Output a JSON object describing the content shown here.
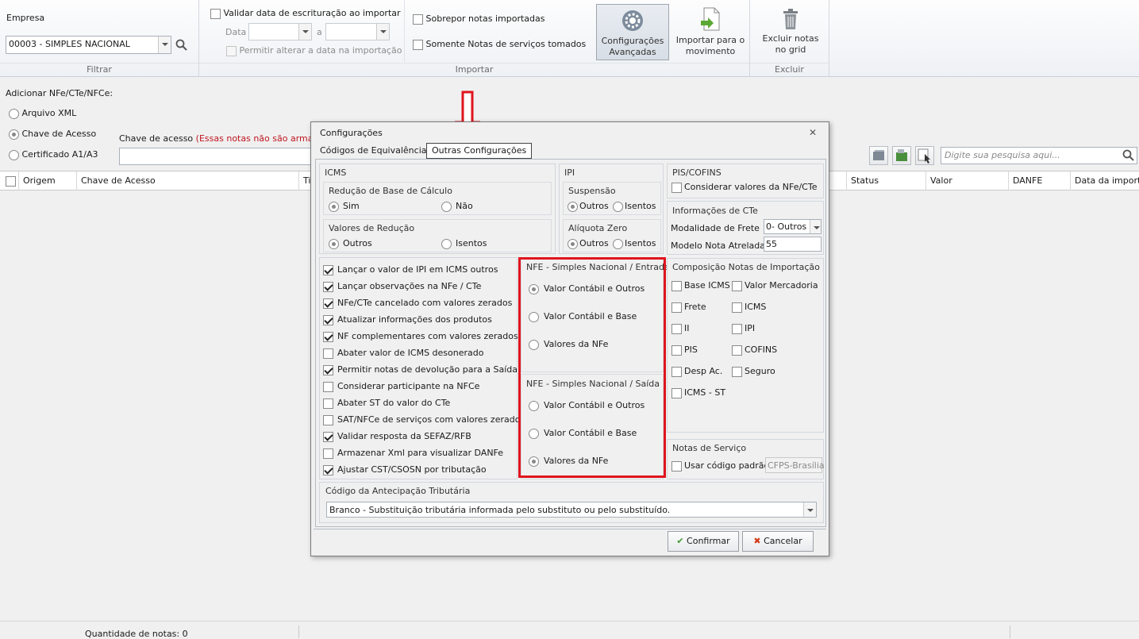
{
  "ribbon": {
    "empresa_label": "Empresa",
    "empresa_value": "00003 - SIMPLES NACIONAL",
    "filtrar_caption": "Filtrar",
    "validar_data_label": "Validar data de escrituração ao importar",
    "data_label": "Data",
    "a_label": "a",
    "permitir_alterar_label": "Permitir alterar a data na importação",
    "sobrepor_label": "Sobrepor notas importadas",
    "somente_servicos_label": "Somente Notas de serviços tomados",
    "config_avancadas_label": "Configurações Avançadas",
    "importar_movimento_label": "Importar para o movimento",
    "importar_caption": "Importar",
    "excluir_notas_label": "Excluir notas no grid",
    "excluir_caption": "Excluir"
  },
  "add": {
    "title": "Adicionar NFe/CTe/NFCe:",
    "arquivo_xml": "Arquivo XML",
    "chave_acesso": "Chave de Acesso",
    "certificado": "Certificado A1/A3",
    "chave_label": "Chave de acesso",
    "chave_note": "(Essas notas não são armazer"
  },
  "search": {
    "placeholder": "Digite sua pesquisa aqui..."
  },
  "grid": {
    "columns": [
      "Origem",
      "Chave de Acesso",
      "Ti",
      "Status",
      "Valor",
      "DANFE",
      "Data da importa"
    ]
  },
  "status": {
    "quantidade": "Quantidade de notas: 0"
  },
  "dialog": {
    "title": "Configurações",
    "tabs": [
      "Códigos de Equivalência",
      "Outras Configurações"
    ],
    "icms": {
      "title": "ICMS",
      "reducao_title": "Redução de Base de Cálculo",
      "sim": "Sim",
      "nao": "Não",
      "valores_title": "Valores de Redução",
      "outros": "Outros",
      "isentos": "Isentos"
    },
    "ipi": {
      "title": "IPI",
      "suspensao": "Suspensão",
      "aliquota_zero": "Alíquota Zero",
      "outros": "Outros",
      "isentos": "Isentos"
    },
    "pis": {
      "title": "PIS/COFINS",
      "considerar": "Considerar valores da NFe/CTe"
    },
    "cte": {
      "title": "Informações de CTe",
      "modalidade_label": "Modalidade de Frete",
      "modalidade_value": "0- Outros",
      "modelo_label": "Modelo Nota Atrelada",
      "modelo_value": "55"
    },
    "checks": [
      {
        "label": "Lançar o valor de IPI em ICMS outros",
        "checked": true
      },
      {
        "label": "Lançar observações na NFe / CTe",
        "checked": true
      },
      {
        "label": "NFe/CTe cancelado com valores zerados",
        "checked": true
      },
      {
        "label": "Atualizar informações dos produtos",
        "checked": true
      },
      {
        "label": "NF complementares com valores zerados",
        "checked": true
      },
      {
        "label": "Abater valor de ICMS desonerado",
        "checked": false
      },
      {
        "label": "Permitir notas de devolução para a Saída",
        "checked": true
      },
      {
        "label": "Considerar participante na NFCe",
        "checked": false
      },
      {
        "label": "Abater ST do valor do CTe",
        "checked": false
      },
      {
        "label": "SAT/NFCe de serviços com valores zerados",
        "checked": false
      },
      {
        "label": "Validar resposta da SEFAZ/RFB",
        "checked": true
      },
      {
        "label": "Armazenar Xml para visualizar DANFe",
        "checked": false
      },
      {
        "label": "Ajustar CST/CSOSN por tributação",
        "checked": true
      }
    ],
    "entrada": {
      "title": "NFE - Simples Nacional / Entrada",
      "options": [
        "Valor Contábil e Outros",
        "Valor Contábil e Base",
        "Valores da NFe"
      ],
      "selected": 0
    },
    "saida": {
      "title": "NFE - Simples Nacional / Saída",
      "options": [
        "Valor Contábil e Outros",
        "Valor Contábil e Base",
        "Valores da NFe"
      ],
      "selected": 2
    },
    "composicao": {
      "title": "Composição Notas de Importação",
      "left": [
        "Base ICMS",
        "Frete",
        "II",
        "PIS",
        "Desp Ac.",
        "ICMS - ST"
      ],
      "right": [
        "Valor Mercadoria",
        "ICMS",
        "IPI",
        "COFINS",
        "Seguro"
      ]
    },
    "servico": {
      "title": "Notas de Serviço",
      "usar_codigo": "Usar código padrão",
      "codigo_value": "CFPS-Brasília"
    },
    "antecipacao": {
      "title": "Código da Antecipação Tributária",
      "value": "Branco - Substituição tributária informada pelo substituto ou pelo substituído."
    },
    "confirmar": "Confirmar",
    "cancelar": "Cancelar",
    "close_glyph": "✕"
  },
  "colors": {
    "annotation_red": "#e0141e"
  }
}
